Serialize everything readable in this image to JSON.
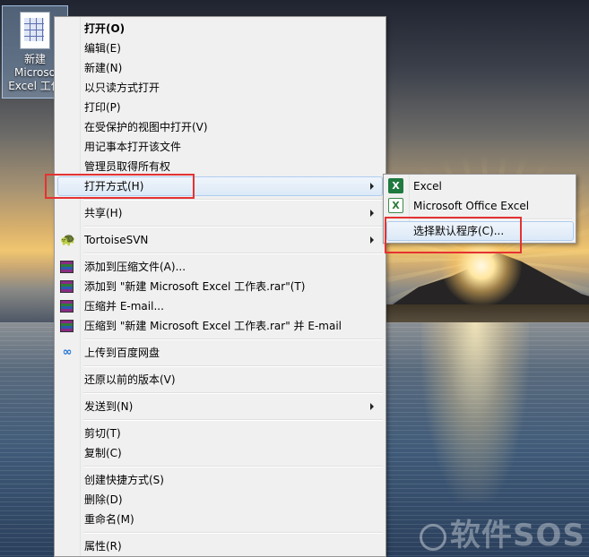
{
  "desktop_icon": {
    "label_lines": [
      "新建",
      "Microso",
      "Excel 工作"
    ]
  },
  "context_menu": {
    "items": [
      {
        "label": "打开(O)",
        "bold": true
      },
      {
        "label": "编辑(E)"
      },
      {
        "label": "新建(N)"
      },
      {
        "label": "以只读方式打开"
      },
      {
        "label": "打印(P)"
      },
      {
        "label": "在受保护的视图中打开(V)"
      },
      {
        "label": "用记事本打开该文件"
      },
      {
        "label": "管理员取得所有权"
      },
      {
        "label": "打开方式(H)",
        "submenu": true,
        "highlighted": true
      },
      {
        "label": "共享(H)",
        "submenu": true
      },
      {
        "label": "TortoiseSVN",
        "submenu": true,
        "icon": "tortoisesvn-icon"
      },
      {
        "label": "添加到压缩文件(A)...",
        "icon": "winrar-icon"
      },
      {
        "label": "添加到 \"新建 Microsoft Excel 工作表.rar\"(T)",
        "icon": "winrar-icon"
      },
      {
        "label": "压缩并 E-mail...",
        "icon": "winrar-icon"
      },
      {
        "label": "压缩到 \"新建 Microsoft Excel 工作表.rar\" 并 E-mail",
        "icon": "winrar-icon"
      },
      {
        "label": "上传到百度网盘",
        "icon": "baidu-netdisk-icon"
      },
      {
        "label": "还原以前的版本(V)"
      },
      {
        "label": "发送到(N)",
        "submenu": true
      },
      {
        "label": "剪切(T)"
      },
      {
        "label": "复制(C)"
      },
      {
        "label": "创建快捷方式(S)"
      },
      {
        "label": "删除(D)"
      },
      {
        "label": "重命名(M)"
      },
      {
        "label": "属性(R)"
      }
    ]
  },
  "open_with_submenu": {
    "items": [
      {
        "label": "Excel",
        "icon": "excel-icon"
      },
      {
        "label": "Microsoft Office Excel",
        "icon": "excel-legacy-icon"
      },
      {
        "label": "选择默认程序(C)...",
        "highlighted": true
      }
    ]
  },
  "watermark": "软件SOS",
  "colors": {
    "highlight_border": "#e53232",
    "menu_background": "#f0f0f0",
    "selection": "#dce9f7"
  }
}
